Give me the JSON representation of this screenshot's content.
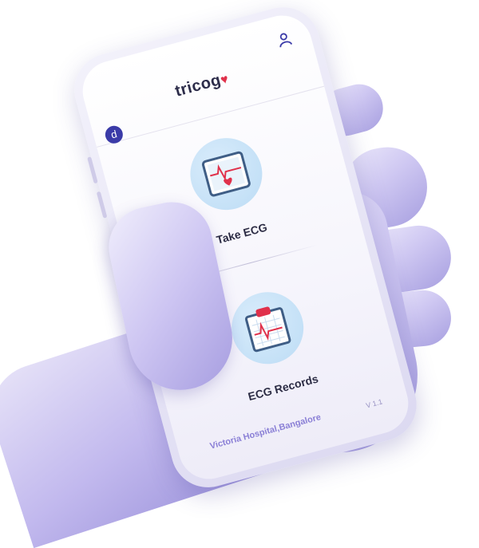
{
  "app": {
    "logo_text": "tricog",
    "avatar_letter": "d"
  },
  "menu": {
    "take_ecg_label": "Take ECG",
    "ecg_records_label": "ECG Records"
  },
  "footer": {
    "location": "Victoria Hospital,Bangalore",
    "version": "V 1.1"
  },
  "colors": {
    "accent": "#3b3ba8",
    "heart": "#e0314b",
    "tile_bg": "#bcdcf5",
    "footer_text": "#8a7fd6"
  },
  "icons": {
    "avatar": "avatar",
    "user": "user-icon",
    "take_ecg": "ecg-monitor-icon",
    "ecg_records": "ecg-clipboard-icon"
  }
}
